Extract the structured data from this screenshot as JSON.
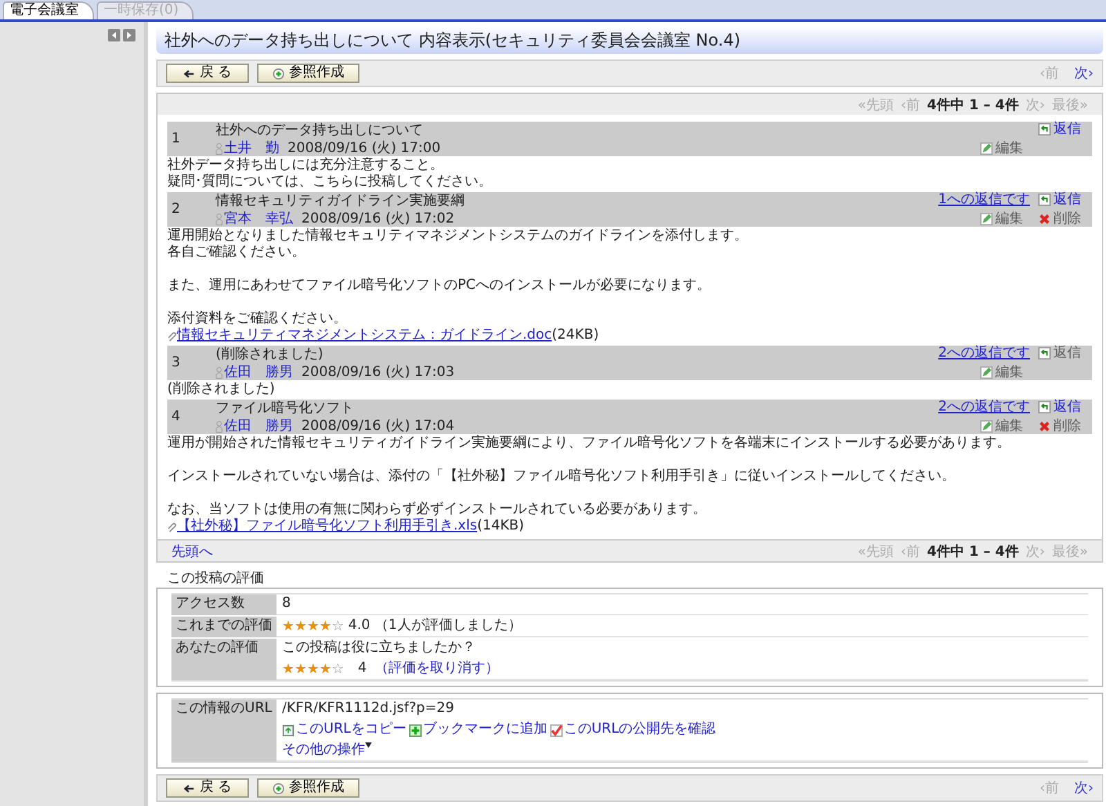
{
  "tabs": [
    {
      "label": "電子会議室",
      "selected": true
    },
    {
      "label": "一時保存(0)",
      "selected": false
    }
  ],
  "page_title": "社外へのデータ持ち出しについて 内容表示(セキュリティ委員会会議室 No.4)",
  "top_bar": {
    "buttons": [
      {
        "kind": "back",
        "label": "戻 る"
      },
      {
        "kind": "reference",
        "label": "参照作成"
      }
    ],
    "nav": [
      {
        "label": "‹前",
        "disabled": true
      },
      {
        "label": "次›",
        "disabled": false
      }
    ]
  },
  "pager": [
    {
      "label": "«先頭",
      "disabled": true
    },
    {
      "label": "‹前",
      "disabled": true
    },
    {
      "label": "4件中 1 – 4件",
      "kind": "count"
    },
    {
      "label": "次›",
      "disabled": true
    },
    {
      "label": "最後»",
      "disabled": true
    }
  ],
  "posts": [
    {
      "number": "1",
      "title": "社外へのデータ持ち出しについて",
      "author": "土井　勤",
      "datetime": "2008/09/16 (火) 17:00",
      "reply": {
        "label": "返信",
        "disabled": false
      },
      "edit": {
        "label": "編集",
        "disabled": true
      },
      "paragraphs": [
        [
          "社外データ持ち出しには充分注意すること。",
          "疑問･質問については、こちらに投稿してください。"
        ]
      ]
    },
    {
      "number": "2",
      "title": "情報セキュリティガイドライン実施要綱",
      "author": "宮本　幸弘",
      "datetime": "2008/09/16 (火) 17:02",
      "reply_to": "1への返信です",
      "reply": {
        "label": "返信",
        "disabled": false
      },
      "edit": {
        "label": "編集",
        "disabled": true
      },
      "delete": {
        "label": "削除",
        "disabled": true
      },
      "paragraphs": [
        [
          "運用開始となりました情報セキュリティマネジメントシステムのガイドラインを添付します。",
          "各自ご確認ください。"
        ],
        [
          "また、運用にあわせてファイル暗号化ソフトのPCへのインストールが必要になります。"
        ],
        [
          "添付資料をご確認ください。"
        ]
      ],
      "attachment": {
        "name": "情報セキュリティマネジメントシステム：ガイドライン.doc",
        "size": "(24KB)"
      }
    },
    {
      "number": "3",
      "title": "(削除されました)",
      "author": "佐田　勝男",
      "datetime": "2008/09/16 (火) 17:03",
      "reply_to": "2への返信です",
      "reply": {
        "label": "返信",
        "disabled": true
      },
      "edit": {
        "label": "編集",
        "disabled": true
      },
      "paragraphs": [
        [
          "(削除されました)"
        ]
      ]
    },
    {
      "number": "4",
      "title": "ファイル暗号化ソフト",
      "author": "佐田　勝男",
      "datetime": "2008/09/16 (火) 17:04",
      "reply_to": "2への返信です",
      "reply": {
        "label": "返信",
        "disabled": false
      },
      "edit": {
        "label": "編集",
        "disabled": true
      },
      "delete": {
        "label": "削除",
        "disabled": true
      },
      "paragraphs": [
        [
          "運用が開始された情報セキュリティガイドライン実施要綱により、ファイル暗号化ソフトを各端末にインストールする必要があります。"
        ],
        [
          "インストールされていない場合は、添付の「【社外秘】ファイル暗号化ソフト利用手引き」に従いインストールしてください。"
        ],
        [
          "なお、当ソフトは使用の有無に関わらず必ずインストールされている必要があります。"
        ]
      ],
      "attachment": {
        "name": "【社外秘】ファイル暗号化ソフト利用手引き.xls",
        "size": "(14KB)"
      }
    }
  ],
  "top_link": "先頭へ",
  "bottom_pager": [
    {
      "label": "«先頭",
      "disabled": true
    },
    {
      "label": "‹前",
      "disabled": true
    },
    {
      "label": "4件中 1 – 4件",
      "kind": "count"
    },
    {
      "label": "次›",
      "disabled": true
    },
    {
      "label": "最後»",
      "disabled": true
    }
  ],
  "evaluation": {
    "heading": "この投稿の評価",
    "access_label": "アクセス数",
    "access_count": "8",
    "rating_label": "これまでの評価",
    "rating": {
      "stars": 4,
      "text": "4.0 （1人が評価しました）"
    },
    "your_label": "あなたの評価",
    "question": "この投稿は役に立ちましたか？",
    "your_rating": {
      "stars": 4,
      "value": "4",
      "cancel": "（評価を取り消す）"
    }
  },
  "url_info": {
    "label": "この情報のURL",
    "url": "/KFR/KFR1112d.jsf?p=29",
    "actions": [
      {
        "kind": "copy",
        "label": "このURLをコピー"
      },
      {
        "kind": "bookmark",
        "label": "ブックマークに追加"
      },
      {
        "kind": "check",
        "label": "このURLの公開先を確認"
      }
    ],
    "more": "その他の操作"
  },
  "bottom_bar": {
    "buttons": [
      {
        "kind": "back",
        "label": "戻 る"
      },
      {
        "kind": "reference",
        "label": "参照作成"
      }
    ],
    "nav": [
      {
        "label": "‹前",
        "disabled": true
      },
      {
        "label": "次›",
        "disabled": false
      }
    ]
  }
}
